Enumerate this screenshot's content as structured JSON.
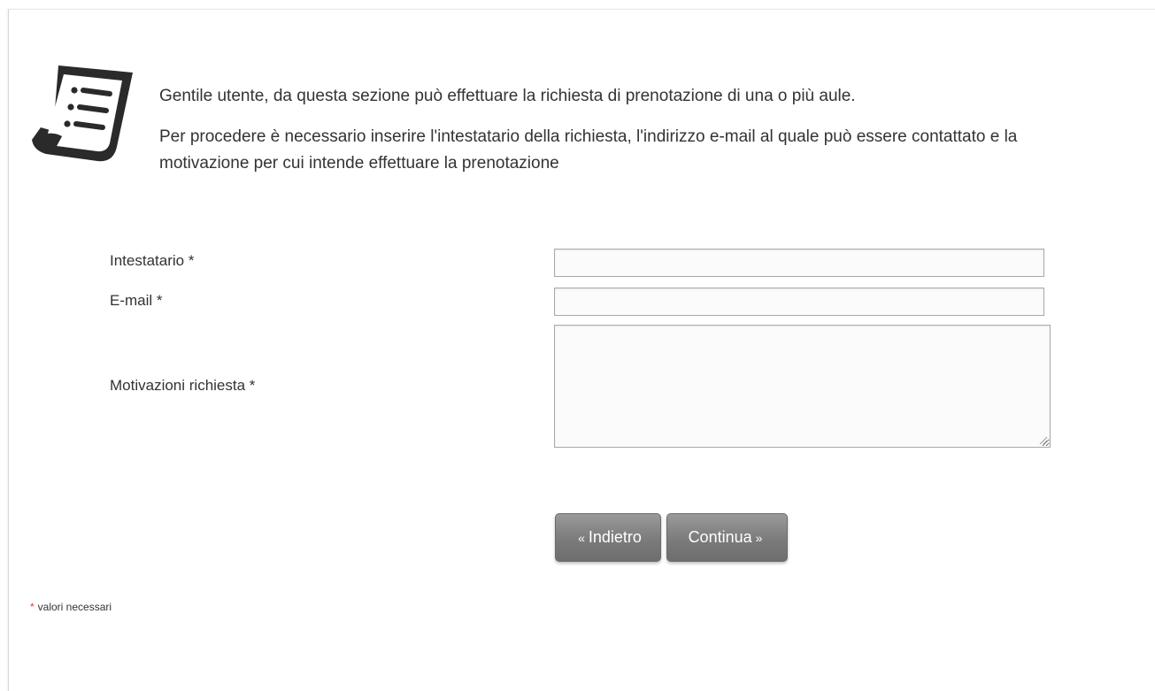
{
  "intro": {
    "line1": "Gentile utente, da questa sezione può effettuare la richiesta di prenotazione di una o più aule.",
    "line2": "Per procedere è necessario inserire l'intestatario della richiesta, l'indirizzo e-mail al quale può essere contattato e la motivazione per cui intende effettuare la prenotazione"
  },
  "form": {
    "intestatario": {
      "label": "Intestatario *",
      "value": ""
    },
    "email": {
      "label": "E-mail *",
      "value": ""
    },
    "motivazioni": {
      "label": "Motivazioni richiesta *",
      "value": ""
    }
  },
  "buttons": {
    "back": {
      "arrow": "«",
      "label": "Indietro"
    },
    "next": {
      "label": "Continua",
      "arrow": "»"
    }
  },
  "footnote": {
    "star": "*",
    "text": "valori necessari"
  },
  "icons": {
    "header": "document-list-icon"
  },
  "colors": {
    "button_gray": "#7b7b7b",
    "required_star": "#e03c3c",
    "text": "#333333"
  }
}
